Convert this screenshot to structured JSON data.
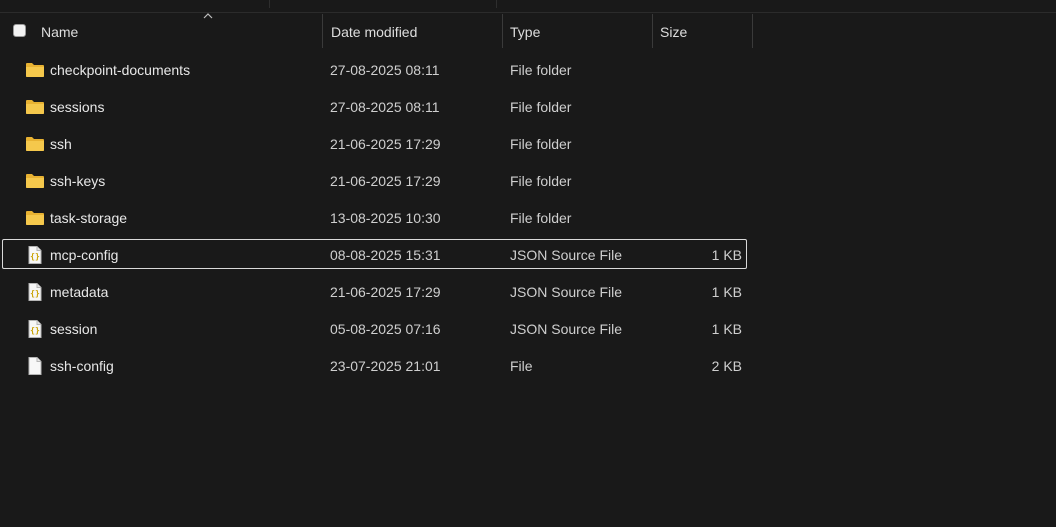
{
  "columns": {
    "name": "Name",
    "date": "Date modified",
    "type": "Type",
    "size": "Size"
  },
  "colors": {
    "background": "#191919",
    "folder": "#f2c14e",
    "json_brace": "#d4b106",
    "focus_border": "#d9d9d9"
  },
  "files": [
    {
      "name": "checkpoint-documents",
      "date": "27-08-2025 08:11",
      "type": "File folder",
      "size": "",
      "icon": "folder-icon"
    },
    {
      "name": "sessions",
      "date": "27-08-2025 08:11",
      "type": "File folder",
      "size": "",
      "icon": "folder-icon"
    },
    {
      "name": "ssh",
      "date": "21-06-2025 17:29",
      "type": "File folder",
      "size": "",
      "icon": "folder-icon"
    },
    {
      "name": "ssh-keys",
      "date": "21-06-2025 17:29",
      "type": "File folder",
      "size": "",
      "icon": "folder-icon"
    },
    {
      "name": "task-storage",
      "date": "13-08-2025 10:30",
      "type": "File folder",
      "size": "",
      "icon": "folder-icon"
    },
    {
      "name": "mcp-config",
      "date": "08-08-2025 15:31",
      "type": "JSON Source File",
      "size": "1 KB",
      "icon": "json-file-icon",
      "focused": true
    },
    {
      "name": "metadata",
      "date": "21-06-2025 17:29",
      "type": "JSON Source File",
      "size": "1 KB",
      "icon": "json-file-icon"
    },
    {
      "name": "session",
      "date": "05-08-2025 07:16",
      "type": "JSON Source File",
      "size": "1 KB",
      "icon": "json-file-icon"
    },
    {
      "name": "ssh-config",
      "date": "23-07-2025 21:01",
      "type": "File",
      "size": "2 KB",
      "icon": "file-icon"
    }
  ]
}
